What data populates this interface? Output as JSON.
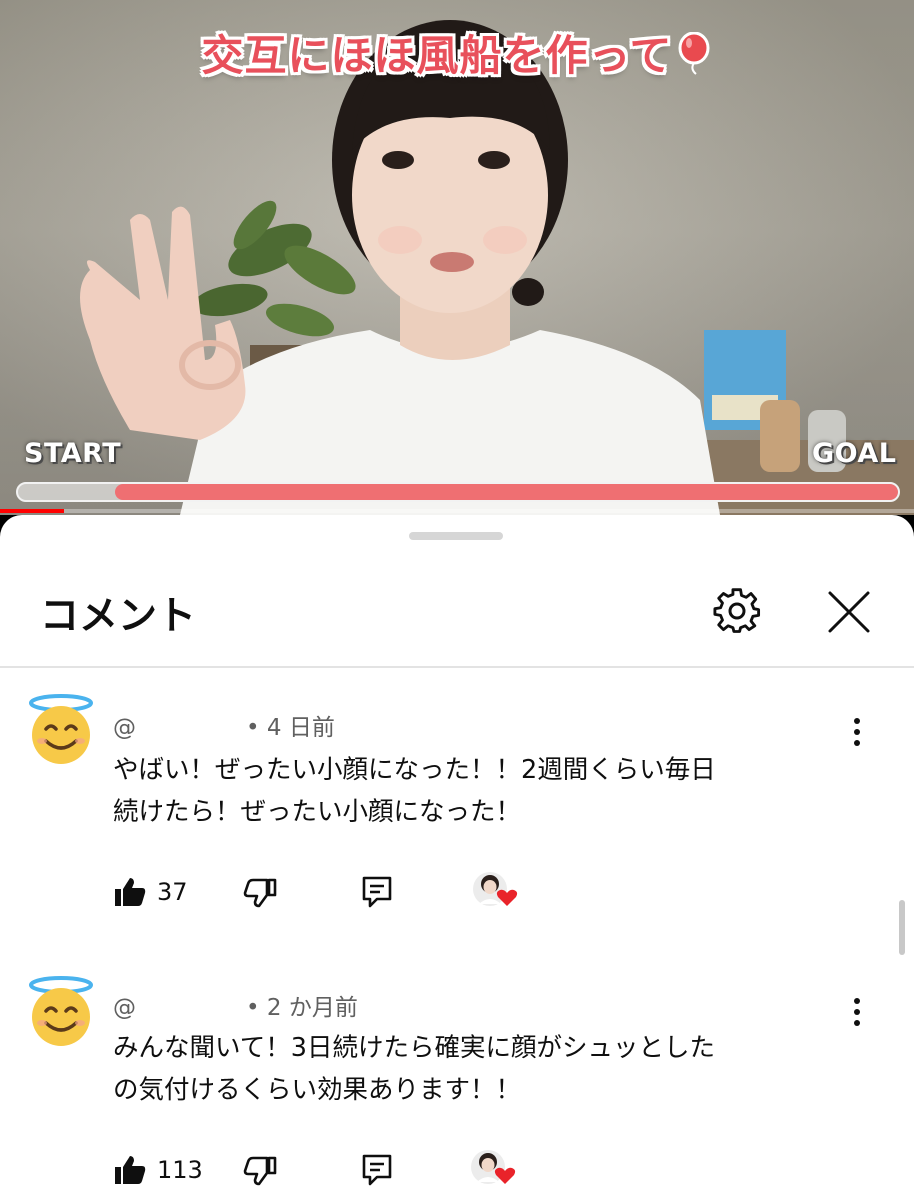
{
  "video": {
    "title": "交互にほほ風船を作って",
    "start_label": "START",
    "goal_label": "GOAL",
    "progress_fraction": 0.89,
    "playback_fraction": 0.07,
    "colors": {
      "title": "#e8505b",
      "progress": "#ef6f72",
      "playbar": "#ff0000"
    },
    "balloon_icon": "balloon-icon"
  },
  "comments_panel": {
    "title": "コメント",
    "settings_icon": "gear-icon",
    "close_icon": "close-icon"
  },
  "comments": [
    {
      "handle": "@",
      "time": "• 4 日前",
      "text_line1": "やばい！ぜったい小顔になった！！2週間くらい毎日",
      "text_line2": "続けたら！ぜったい小顔になった！",
      "likes": "37",
      "avatar_icon": "smiling-face-with-halo-icon"
    },
    {
      "handle": "@",
      "time": "• 2 か月前",
      "text_line1": "みんな聞いて！3日続けたら確実に顔がシュッとした",
      "text_line2": "の気付けるくらい効果あります！！",
      "likes": "113",
      "avatar_icon": "smiling-face-with-halo-icon"
    }
  ]
}
